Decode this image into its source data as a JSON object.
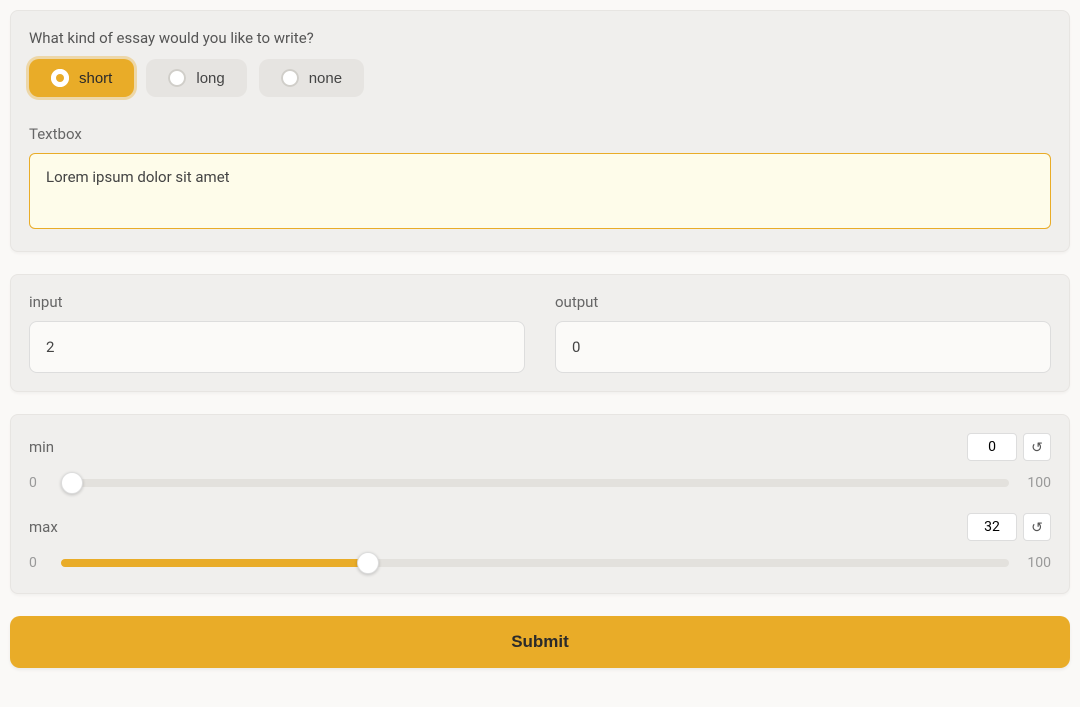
{
  "essay": {
    "question": "What kind of essay would you like to write?",
    "options": [
      {
        "value": "short",
        "label": "short",
        "selected": true
      },
      {
        "value": "long",
        "label": "long",
        "selected": false
      },
      {
        "value": "none",
        "label": "none",
        "selected": false
      }
    ],
    "textbox_label": "Textbox",
    "textbox_value": "Lorem ipsum dolor sit amet"
  },
  "io": {
    "input_label": "input",
    "input_value": "2",
    "output_label": "output",
    "output_value": "0"
  },
  "sliders": {
    "min": {
      "label": "min",
      "low": "0",
      "high": "100",
      "value": "0"
    },
    "max": {
      "label": "max",
      "low": "0",
      "high": "100",
      "value": "32"
    }
  },
  "submit_label": "Submit",
  "icons": {
    "reset": "↺"
  }
}
